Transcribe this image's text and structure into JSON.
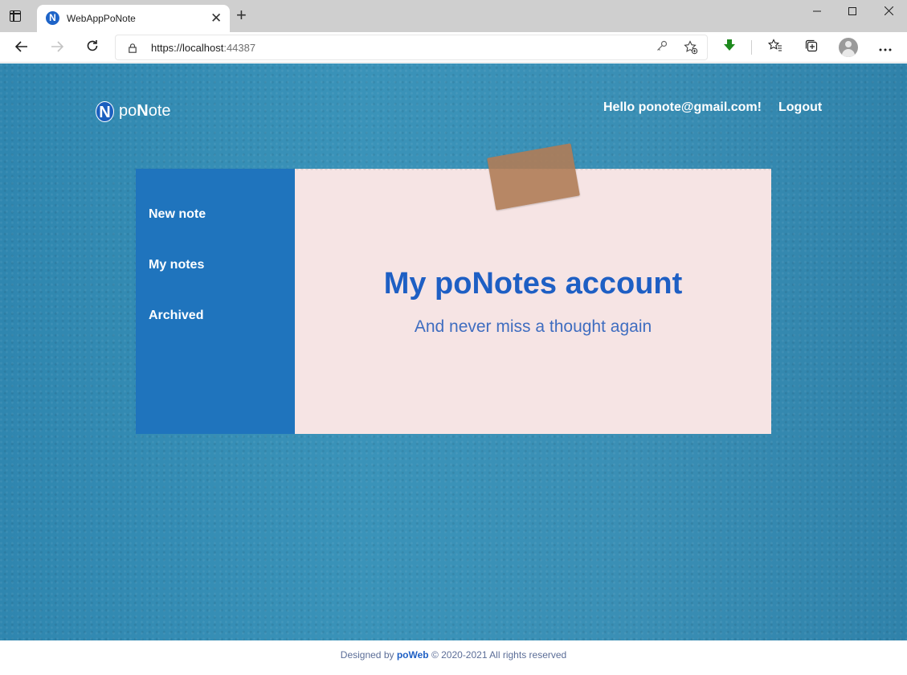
{
  "browser": {
    "tab_title": "WebAppPoNote",
    "tab_favicon_letter": "N",
    "close_tab_glyph": "✕",
    "new_tab_glyph": "+",
    "url_host": "https://localhost",
    "url_port": ":44387",
    "icons": [
      "tab-actions-icon",
      "back-icon",
      "forward-icon",
      "refresh-icon",
      "lock-icon",
      "key-icon",
      "add-favorite-icon",
      "download-icon",
      "favorites-icon",
      "collections-icon",
      "profile-icon",
      "more-icon",
      "minimize-icon",
      "maximize-icon",
      "close-window-icon"
    ]
  },
  "header": {
    "brand_mark": "N",
    "brand_prefix": "po",
    "brand_bold": "N",
    "brand_suffix": "ote",
    "greeting": "Hello ponote@gmail.com!",
    "logout_label": "Logout"
  },
  "sidebar": {
    "items": [
      {
        "label": "New note"
      },
      {
        "label": "My notes"
      },
      {
        "label": "Archived"
      }
    ]
  },
  "card": {
    "title": "My poNotes account",
    "subtitle": "And never miss a thought again"
  },
  "footer": {
    "prefix": "Designed by ",
    "brand": "poWeb",
    "suffix": " © 2020-2021 All rights reserved"
  },
  "colors": {
    "accent": "#1e5fc4",
    "sidebar": "#1f74bd",
    "background": "#3b91b6",
    "card": "#f6e4e4",
    "download": "#1e8a1e"
  }
}
